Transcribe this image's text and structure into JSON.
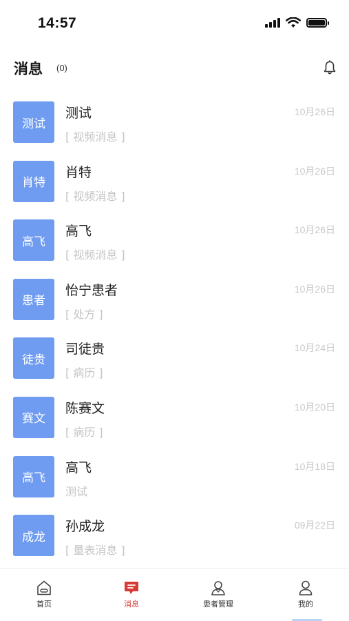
{
  "status_bar": {
    "time": "14:57"
  },
  "header": {
    "title": "消息",
    "count": "(0)"
  },
  "messages": [
    {
      "avatar": "测试",
      "name": "测试",
      "preview": "[ 视频消息 ]",
      "date": "10月26日"
    },
    {
      "avatar": "肖特",
      "name": "肖特",
      "preview": "[ 视频消息 ]",
      "date": "10月26日"
    },
    {
      "avatar": "高飞",
      "name": "高飞",
      "preview": "[ 视频消息 ]",
      "date": "10月26日"
    },
    {
      "avatar": "患者",
      "name": "怡宁患者",
      "preview": "[ 处方 ]",
      "date": "10月26日"
    },
    {
      "avatar": "徒贵",
      "name": "司徒贵",
      "preview": "[ 病历 ]",
      "date": "10月24日"
    },
    {
      "avatar": "赛文",
      "name": "陈赛文",
      "preview": "[ 病历 ]",
      "date": "10月20日"
    },
    {
      "avatar": "高飞",
      "name": "高飞",
      "preview": "测试",
      "date": "10月18日"
    },
    {
      "avatar": "成龙",
      "name": "孙成龙",
      "preview": "[ 量表消息 ]",
      "date": "09月22日"
    }
  ],
  "tabs": [
    {
      "label": "首页",
      "icon": "home-icon"
    },
    {
      "label": "消息",
      "icon": "message-icon",
      "active": true
    },
    {
      "label": "患者管理",
      "icon": "patient-icon"
    },
    {
      "label": "我的",
      "icon": "profile-icon"
    }
  ],
  "colors": {
    "avatar_bg": "#6f9cf0",
    "active_tab": "#d63b36"
  }
}
